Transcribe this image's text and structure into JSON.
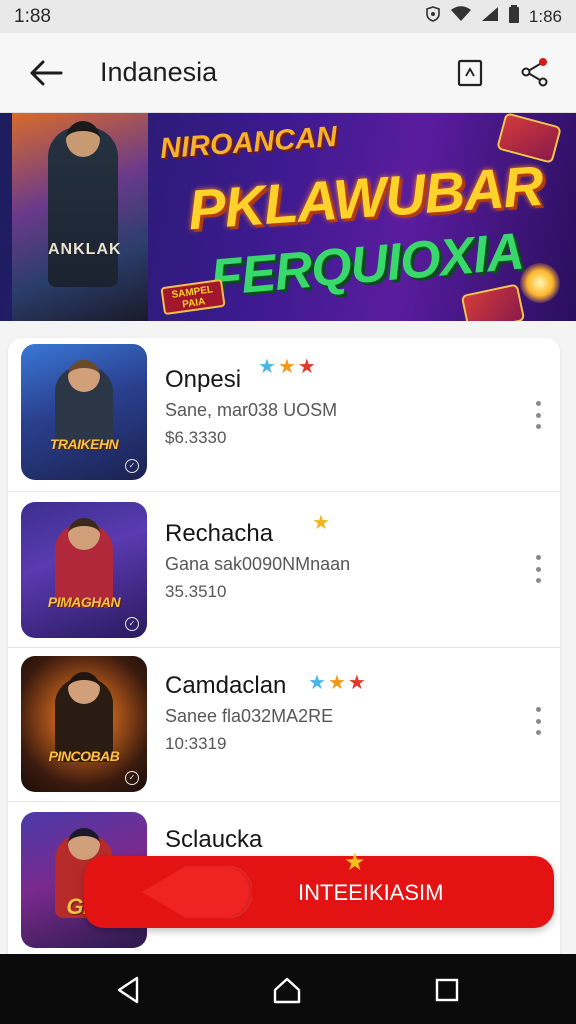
{
  "status_bar": {
    "time": "1:88",
    "battery_text": "1:86",
    "icons": [
      "shield-icon",
      "wifi-icon",
      "signal-icon",
      "battery-icon"
    ]
  },
  "app_bar": {
    "title": "Indanesia",
    "icons": [
      "back-arrow-icon",
      "bookmark-icon",
      "share-icon"
    ]
  },
  "banner": {
    "line1": "NIROANCAN",
    "line2": "PKLAWUBAR",
    "line3": "FERQUIOXIA",
    "art_label": "ANKLAK",
    "tag": "SAMPEL PAIA"
  },
  "games": [
    {
      "title": "Onpesi",
      "subtitle": "Sane, mar038 UOSM",
      "price": "$6.3330",
      "thumb_label": "TRAIKEHN",
      "stars": [
        "blue",
        "orange",
        "red"
      ]
    },
    {
      "title": "Rechacha",
      "subtitle": "Gana sak0090NMnaan",
      "price": "35.3510",
      "thumb_label": "PIMAGHAN",
      "stars": [
        "gold"
      ]
    },
    {
      "title": "Camdaclan",
      "subtitle": "Sanee fla032MA2RE",
      "price": "10:3319",
      "thumb_label": "PINCOBAB",
      "stars": [
        "blue",
        "orange",
        "red"
      ]
    },
    {
      "title": "Sclaucka",
      "subtitle": "",
      "price": "",
      "thumb_label": "GIL",
      "stars": []
    }
  ],
  "cta": {
    "label": "INTEEIKIASIM"
  },
  "nav": {
    "icons": [
      "back-triangle-icon",
      "home-icon",
      "recents-icon"
    ]
  },
  "colors": {
    "accent_red": "#e31313",
    "banner_purple": "#3b1a8e",
    "star_gold": "#f2b51f"
  }
}
